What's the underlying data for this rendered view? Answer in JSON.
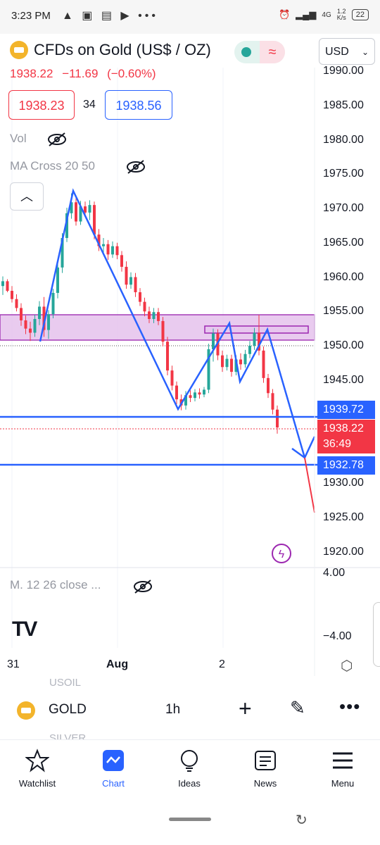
{
  "status_bar": {
    "time": "3:23 PM",
    "left_icons": "▲ ▣ ▤ ▶ •••",
    "net": "4G",
    "speed_top": "1.2",
    "speed_bottom": "K/s",
    "battery": "22"
  },
  "header": {
    "symbol_title": "CFDs on Gold (US$ / OZ)",
    "currency": "USD",
    "last_price": "1938.22",
    "change": "−11.69",
    "change_pct": "(−0.60%)",
    "bid": "1938.23",
    "spread": "34",
    "ask": "1938.56",
    "market_status_icon": "market-open-dot",
    "delay_icon": "wave-icon"
  },
  "indicators": {
    "vol_label": "Vol",
    "ma_label": "MA Cross 20 50",
    "macd_label": "M. 12 26 close ..."
  },
  "price_axis": {
    "labels": [
      "1990.00",
      "1985.00",
      "1980.00",
      "1975.00",
      "1970.00",
      "1965.00",
      "1960.00",
      "1955.00",
      "1950.00",
      "1945.00",
      "1930.00",
      "1925.00",
      "1920.00"
    ],
    "tag_upper": "1939.72",
    "tag_current": "1938.22",
    "tag_countdown": "36:49",
    "tag_lower": "1932.78"
  },
  "osc_axis": {
    "top": "4.00",
    "bottom": "−4.00"
  },
  "time_axis": {
    "labels": [
      "31",
      "Aug",
      "2"
    ]
  },
  "ghost": {
    "upper": "USOIL",
    "lower": "SILVER"
  },
  "toolbar": {
    "symbol": "GOLD",
    "interval": "1h"
  },
  "nav": {
    "items": [
      {
        "label": "Watchlist",
        "icon": "star-icon"
      },
      {
        "label": "Chart",
        "icon": "chart-icon"
      },
      {
        "label": "Ideas",
        "icon": "lightbulb-icon"
      },
      {
        "label": "News",
        "icon": "news-icon"
      },
      {
        "label": "Menu",
        "icon": "menu-icon"
      }
    ]
  },
  "colors": {
    "up": "#26a69a",
    "down": "#f23645",
    "accent": "#2962ff",
    "zone": "#9c27b0"
  },
  "chart_data": {
    "type": "candlestick",
    "symbol": "GOLD",
    "timeframe": "1h",
    "ylim": [
      1917,
      1992
    ],
    "candles": [
      [
        1958.8,
        1960.2,
        1957.5,
        1959.5
      ],
      [
        1959.5,
        1959.8,
        1957.9,
        1958.1
      ],
      [
        1958.1,
        1958.8,
        1956.4,
        1956.9
      ],
      [
        1956.9,
        1957.6,
        1955.1,
        1955.6
      ],
      [
        1955.6,
        1956.3,
        1953.0,
        1953.8
      ],
      [
        1953.8,
        1954.5,
        1951.8,
        1952.6
      ],
      [
        1952.6,
        1953.6,
        1950.8,
        1952.0
      ],
      [
        1952.0,
        1954.6,
        1951.4,
        1954.0
      ],
      [
        1954.0,
        1956.6,
        1953.1,
        1955.8
      ],
      [
        1955.8,
        1957.2,
        1951.4,
        1952.4
      ],
      [
        1952.4,
        1955.3,
        1951.1,
        1954.7
      ],
      [
        1954.7,
        1958.4,
        1954.1,
        1957.8
      ],
      [
        1957.8,
        1962.3,
        1957.0,
        1961.5
      ],
      [
        1961.5,
        1966.5,
        1960.7,
        1965.8
      ],
      [
        1965.8,
        1970.2,
        1965.2,
        1969.4
      ],
      [
        1969.4,
        1972.3,
        1968.6,
        1971.0
      ],
      [
        1971.0,
        1971.6,
        1967.6,
        1968.2
      ],
      [
        1968.2,
        1971.2,
        1967.7,
        1970.4
      ],
      [
        1970.4,
        1971.1,
        1968.9,
        1969.5
      ],
      [
        1969.5,
        1971.3,
        1968.4,
        1970.6
      ],
      [
        1970.6,
        1971.1,
        1965.6,
        1966.3
      ],
      [
        1966.3,
        1967.1,
        1963.9,
        1964.6
      ],
      [
        1964.6,
        1965.8,
        1963.4,
        1964.9
      ],
      [
        1964.9,
        1965.5,
        1962.6,
        1963.4
      ],
      [
        1963.4,
        1965.3,
        1962.9,
        1964.6
      ],
      [
        1964.6,
        1965.1,
        1962.7,
        1963.3
      ],
      [
        1963.3,
        1963.9,
        1960.9,
        1961.6
      ],
      [
        1961.6,
        1962.4,
        1958.4,
        1959.0
      ],
      [
        1959.0,
        1960.8,
        1958.4,
        1960.1
      ],
      [
        1960.1,
        1960.7,
        1957.2,
        1957.9
      ],
      [
        1957.9,
        1958.5,
        1955.9,
        1956.5
      ],
      [
        1956.5,
        1957.1,
        1954.4,
        1955.1
      ],
      [
        1955.1,
        1955.8,
        1953.4,
        1954.0
      ],
      [
        1954.0,
        1955.6,
        1953.4,
        1955.0
      ],
      [
        1955.0,
        1955.6,
        1953.1,
        1953.7
      ],
      [
        1953.7,
        1954.3,
        1950.0,
        1950.7
      ],
      [
        1950.7,
        1951.4,
        1945.8,
        1946.5
      ],
      [
        1946.5,
        1947.2,
        1943.6,
        1944.3
      ],
      [
        1944.3,
        1944.9,
        1941.6,
        1942.3
      ],
      [
        1942.3,
        1943.0,
        1940.7,
        1941.4
      ],
      [
        1941.4,
        1943.5,
        1940.8,
        1942.9
      ],
      [
        1942.9,
        1943.6,
        1941.9,
        1942.5
      ],
      [
        1942.5,
        1943.8,
        1942.0,
        1943.3
      ],
      [
        1943.3,
        1943.9,
        1942.4,
        1943.0
      ],
      [
        1943.0,
        1944.1,
        1942.6,
        1943.7
      ],
      [
        1943.7,
        1950.4,
        1943.2,
        1949.6
      ],
      [
        1949.6,
        1952.6,
        1947.8,
        1951.9
      ],
      [
        1951.9,
        1952.5,
        1948.0,
        1948.7
      ],
      [
        1948.7,
        1949.4,
        1946.3,
        1947.0
      ],
      [
        1947.0,
        1948.8,
        1946.5,
        1948.2
      ],
      [
        1948.2,
        1948.8,
        1945.6,
        1946.3
      ],
      [
        1946.3,
        1948.7,
        1945.8,
        1948.1
      ],
      [
        1948.1,
        1949.0,
        1946.6,
        1947.4
      ],
      [
        1947.4,
        1949.5,
        1946.9,
        1948.9
      ],
      [
        1948.9,
        1950.8,
        1948.3,
        1950.1
      ],
      [
        1950.1,
        1952.7,
        1949.5,
        1952.0
      ],
      [
        1952.0,
        1954.6,
        1948.7,
        1949.4
      ],
      [
        1949.4,
        1950.0,
        1944.7,
        1945.4
      ],
      [
        1945.4,
        1946.0,
        1942.5,
        1943.2
      ],
      [
        1943.2,
        1943.8,
        1940.1,
        1940.8
      ],
      [
        1940.8,
        1941.4,
        1937.3,
        1938.2
      ]
    ]
  }
}
